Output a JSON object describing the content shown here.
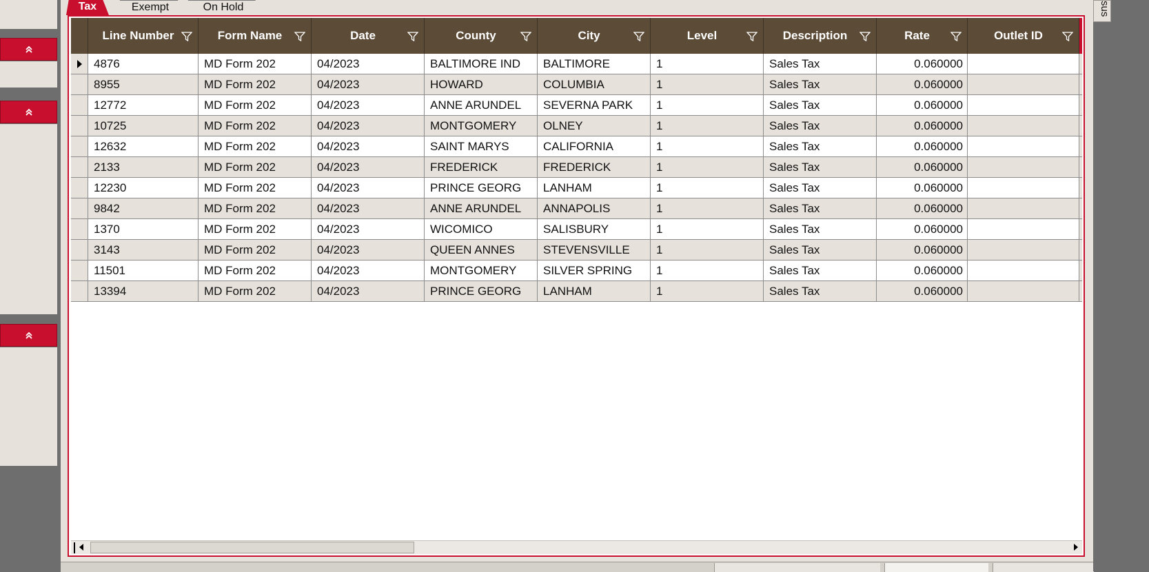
{
  "tabs": [
    {
      "label": "Tax",
      "active": true
    },
    {
      "label": "Exempt",
      "active": false
    },
    {
      "label": "On Hold",
      "active": false
    }
  ],
  "side_tab": {
    "label": "sus"
  },
  "grid": {
    "columns": [
      {
        "key": "line_number",
        "label": "Line Number",
        "width": 160
      },
      {
        "key": "form_name",
        "label": "Form Name",
        "width": 164
      },
      {
        "key": "date",
        "label": "Date",
        "width": 164
      },
      {
        "key": "county",
        "label": "County",
        "width": 164
      },
      {
        "key": "city",
        "label": "City",
        "width": 164
      },
      {
        "key": "level",
        "label": "Level",
        "width": 164
      },
      {
        "key": "description",
        "label": "Description",
        "width": 164
      },
      {
        "key": "rate",
        "label": "Rate",
        "width": 132
      },
      {
        "key": "outlet_id",
        "label": "Outlet ID",
        "width": 162
      }
    ],
    "rows": [
      {
        "line_number": "4876",
        "form_name": "MD Form 202",
        "date": "04/2023",
        "county": "BALTIMORE IND",
        "city": "BALTIMORE",
        "level": "1",
        "description": "Sales Tax",
        "rate": "0.060000",
        "outlet_id": "",
        "current": true
      },
      {
        "line_number": "8955",
        "form_name": "MD Form 202",
        "date": "04/2023",
        "county": "HOWARD",
        "city": "COLUMBIA",
        "level": "1",
        "description": "Sales Tax",
        "rate": "0.060000",
        "outlet_id": ""
      },
      {
        "line_number": "12772",
        "form_name": "MD Form 202",
        "date": "04/2023",
        "county": "ANNE ARUNDEL",
        "city": "SEVERNA PARK",
        "level": "1",
        "description": "Sales Tax",
        "rate": "0.060000",
        "outlet_id": ""
      },
      {
        "line_number": "10725",
        "form_name": "MD Form 202",
        "date": "04/2023",
        "county": "MONTGOMERY",
        "city": "OLNEY",
        "level": "1",
        "description": "Sales Tax",
        "rate": "0.060000",
        "outlet_id": ""
      },
      {
        "line_number": "12632",
        "form_name": "MD Form 202",
        "date": "04/2023",
        "county": "SAINT MARYS",
        "city": "CALIFORNIA",
        "level": "1",
        "description": "Sales Tax",
        "rate": "0.060000",
        "outlet_id": ""
      },
      {
        "line_number": "2133",
        "form_name": "MD Form 202",
        "date": "04/2023",
        "county": "FREDERICK",
        "city": "FREDERICK",
        "level": "1",
        "description": "Sales Tax",
        "rate": "0.060000",
        "outlet_id": ""
      },
      {
        "line_number": "12230",
        "form_name": "MD Form 202",
        "date": "04/2023",
        "county": "PRINCE GEORG",
        "city": "LANHAM",
        "level": "1",
        "description": "Sales Tax",
        "rate": "0.060000",
        "outlet_id": ""
      },
      {
        "line_number": "9842",
        "form_name": "MD Form 202",
        "date": "04/2023",
        "county": "ANNE ARUNDEL",
        "city": "ANNAPOLIS",
        "level": "1",
        "description": "Sales Tax",
        "rate": "0.060000",
        "outlet_id": ""
      },
      {
        "line_number": "1370",
        "form_name": "MD Form 202",
        "date": "04/2023",
        "county": "WICOMICO",
        "city": "SALISBURY",
        "level": "1",
        "description": "Sales Tax",
        "rate": "0.060000",
        "outlet_id": ""
      },
      {
        "line_number": "3143",
        "form_name": "MD Form 202",
        "date": "04/2023",
        "county": "QUEEN ANNES",
        "city": "STEVENSVILLE",
        "level": "1",
        "description": "Sales Tax",
        "rate": "0.060000",
        "outlet_id": ""
      },
      {
        "line_number": "11501",
        "form_name": "MD Form 202",
        "date": "04/2023",
        "county": "MONTGOMERY",
        "city": "SILVER SPRING",
        "level": "1",
        "description": "Sales Tax",
        "rate": "0.060000",
        "outlet_id": ""
      },
      {
        "line_number": "13394",
        "form_name": "MD Form 202",
        "date": "04/2023",
        "county": "PRINCE GEORG",
        "city": "LANHAM",
        "level": "1",
        "description": "Sales Tax",
        "rate": "0.060000",
        "outlet_id": ""
      }
    ],
    "numeric_columns": [
      "rate"
    ]
  },
  "icons": {
    "filter": "filter-icon",
    "collapse": "chevron-double-up-icon",
    "row_pointer": "row-pointer-icon",
    "scroll_left": "scroll-left-icon",
    "scroll_right": "scroll-right-icon"
  },
  "colors": {
    "accent_red": "#c8102e",
    "header_brown": "#5c4b36",
    "alt_row": "#e6e1db"
  }
}
